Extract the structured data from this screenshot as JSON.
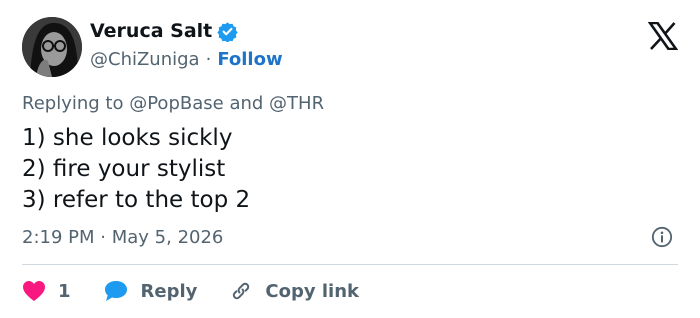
{
  "user": {
    "display_name": "Veruca Salt",
    "handle": "@ChiZuniga",
    "separator": "·",
    "follow_label": "Follow",
    "verified_color": "#1d9bf0"
  },
  "reply": {
    "prefix": "Replying to",
    "mention1": "@PopBase",
    "joiner": "and",
    "mention2": "@THR"
  },
  "tweet": {
    "lines": [
      "1) she looks sickly",
      "2) fire your stylist",
      "3) refer to the top 2"
    ]
  },
  "meta": {
    "time": "2:19 PM",
    "separator": "·",
    "date": "May 5, 2026"
  },
  "actions": {
    "like_count": "1",
    "reply_label": "Reply",
    "copy_label": "Copy link"
  },
  "colors": {
    "like": "#f91880",
    "reply": "#1d9bf0",
    "muted": "#536471"
  },
  "icons": [
    "avatar",
    "verified-badge-icon",
    "x-logo-icon",
    "info-icon",
    "heart-icon",
    "reply-bubble-icon",
    "link-icon"
  ]
}
